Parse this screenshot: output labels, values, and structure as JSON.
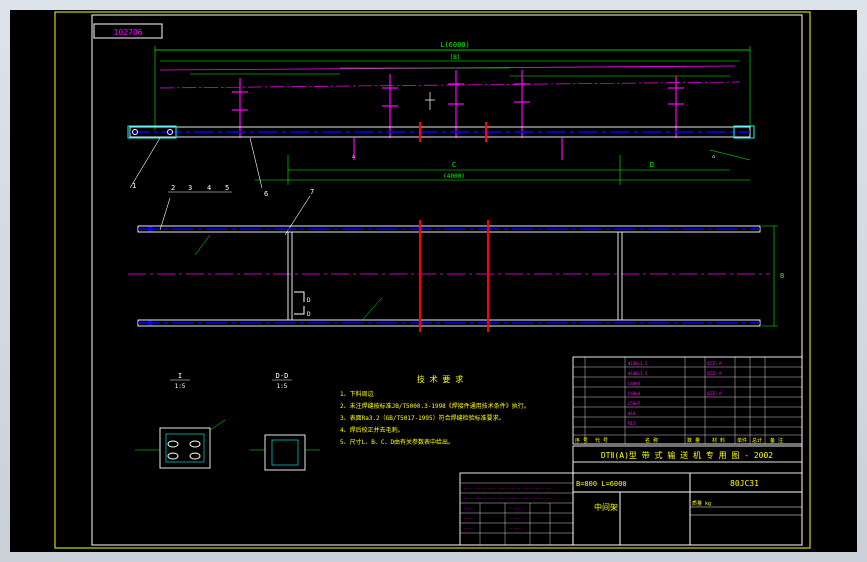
{
  "drawing": {
    "code_box": "102706",
    "dims": {
      "overall": "L(6000)",
      "top_a": "(B)",
      "span_c": "C",
      "span_c_val": "(4000)",
      "span_d": "D",
      "right_dim": "B"
    },
    "labels": {
      "view_d_top": "D",
      "view_d_bottom": "D"
    },
    "balloons": [
      "1",
      "2",
      "3",
      "4",
      "5",
      "6",
      "7"
    ],
    "detail_views": {
      "view_i_title": "I",
      "view_i_scale": "1:5",
      "view_d_title": "D-D",
      "view_d_scale": "1:5"
    },
    "tech_req": {
      "title": "技 术 要 求",
      "items": [
        "1、下料周边",
        "2、未注焊缝按标准JB/T5000.3-1998《焊接件通用技术条件》执行。",
        "3、表面Ra3.2（GB/T5017-1995）符合焊缝检验标准要求。",
        "4、焊后校正并去毛刺。",
        "5、尺寸L、B、C、D由有关参数表中给出。"
      ]
    },
    "title_block": {
      "series": "DTⅡ(A)型 带 式 输 送 机 专 用 图 - 2002",
      "spec": "B=800 L=6000",
      "code": "80JC31",
      "name": "中间架",
      "cols": [
        "序 号",
        "代 号",
        "名 称",
        "数 量",
        "材 料",
        "单件",
        "总计",
        "备 注"
      ],
      "weight": "质量 kg"
    },
    "colors": {
      "background": "#000000",
      "outline": "#ffffff",
      "centerline": "#ff00ff",
      "dim": "#00ff00",
      "cut": "#ff0000",
      "text": "#ffff00",
      "hatch": "#00ffff"
    }
  }
}
